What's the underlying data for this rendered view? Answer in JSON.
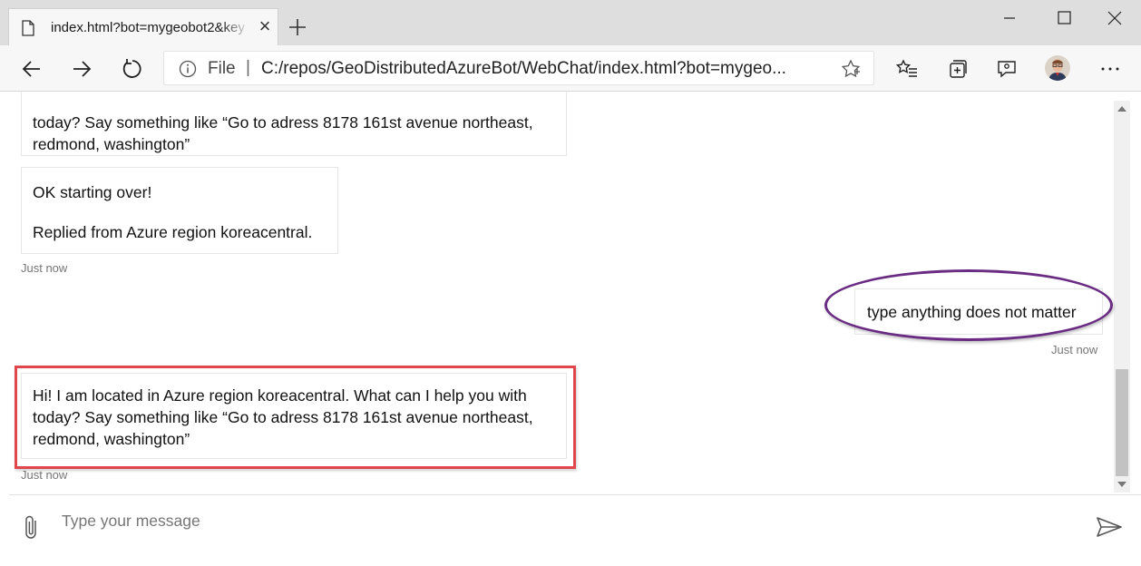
{
  "browser": {
    "tab_title": "index.html?bot=mygeobot2&key",
    "address_scheme": "File",
    "address_separator": "|",
    "url": "C:/repos/GeoDistributedAzureBot/WebChat/index.html?bot=mygeo..."
  },
  "chat": {
    "messages": [
      {
        "from": "bot",
        "text_lines": [
          "today? Say something like “Go to adress 8178 161st avenue northeast,",
          "redmond, washington”"
        ]
      },
      {
        "from": "bot",
        "text_lines": [
          "OK starting over!",
          "Replied from Azure region koreacentral."
        ],
        "timestamp": "Just now"
      },
      {
        "from": "user",
        "text": "type anything does not matter",
        "timestamp": "Just now"
      },
      {
        "from": "bot",
        "text_lines": [
          "Hi! I am located in Azure region koreacentral. What can I help you with",
          "today? Say something like “Go to adress 8178 161st avenue northeast,",
          "redmond, washington”"
        ],
        "timestamp": "Just now"
      }
    ],
    "input_placeholder": "Type your message"
  },
  "annotations": {
    "ellipse_color": "#6a2b83",
    "box_color": "#e0474c"
  },
  "icons": [
    "page-icon",
    "close-icon",
    "plus-icon",
    "minimize-icon",
    "maximize-icon",
    "window-close-icon",
    "back-icon",
    "forward-icon",
    "refresh-icon",
    "info-icon",
    "star-icon",
    "favorites-icon",
    "collections-icon",
    "share-icon",
    "avatar",
    "more-icon",
    "attach-icon",
    "send-icon"
  ]
}
